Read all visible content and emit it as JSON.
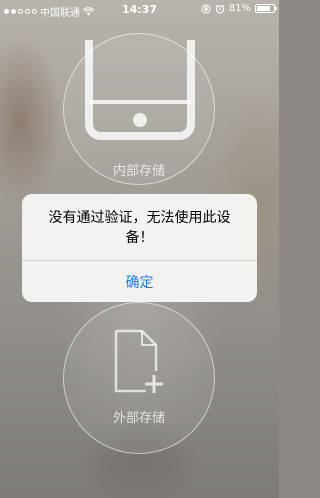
{
  "status_bar": {
    "carrier": "中国联通",
    "time": "14:37",
    "battery": "81%",
    "battery_level": 0.81,
    "signal_dots_filled": 2,
    "signal_dots_total": 5
  },
  "storage": {
    "internal_label": "内部存储",
    "external_label": "外部存储"
  },
  "alert": {
    "message": "没有通过验证，无法使用此设备！",
    "ok_label": "确定"
  },
  "colors": {
    "accent": "#1a7cf4"
  }
}
